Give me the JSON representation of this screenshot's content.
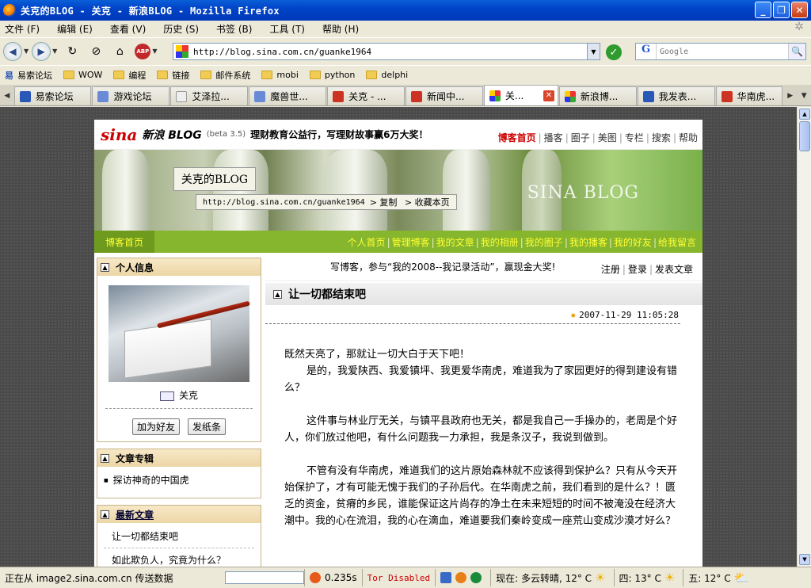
{
  "window": {
    "title": "关克的BLOG - 关克 - 新浪BLOG - Mozilla Firefox"
  },
  "menu": [
    "文件 (F)",
    "编辑 (E)",
    "查看 (V)",
    "历史 (S)",
    "书签 (B)",
    "工具 (T)",
    "帮助 (H)"
  ],
  "nav": {
    "url": "http://blog.sina.com.cn/guanke1964",
    "abp_label": "ABP",
    "search_placeholder": "Google",
    "search_engine_letter": "G"
  },
  "bookmarks": [
    {
      "label": "易索论坛",
      "kind": "yi"
    },
    {
      "label": "WOW",
      "kind": "folder"
    },
    {
      "label": "编程",
      "kind": "folder"
    },
    {
      "label": "链接",
      "kind": "folder"
    },
    {
      "label": "邮件系统",
      "kind": "folder"
    },
    {
      "label": "mobi",
      "kind": "folder"
    },
    {
      "label": "python",
      "kind": "folder"
    },
    {
      "label": "delphi",
      "kind": "folder"
    }
  ],
  "tabs": [
    {
      "label": "易索论坛",
      "color": "#2a58b8"
    },
    {
      "label": "游戏论坛",
      "color": "#6a8ad8"
    },
    {
      "label": "艾泽拉...",
      "color": "#eeeeee"
    },
    {
      "label": "魔兽世...",
      "color": "#6a8ad8"
    },
    {
      "label": "关克 - ...",
      "color": "#cc3322"
    },
    {
      "label": "新闻中...",
      "color": "#cc3322"
    },
    {
      "label": "关...",
      "color": "#e8a020",
      "active": true
    },
    {
      "label": "新浪博...",
      "color": "#e8a020"
    },
    {
      "label": "我发表...",
      "color": "#2a58b8"
    },
    {
      "label": "华南虎...",
      "color": "#cc3322"
    }
  ],
  "blog": {
    "sina_logo": "sina",
    "sina_blog": "新浪 BLOG",
    "beta": "(beta 3.5)",
    "promo": "理财教育公益行，写理财故事赢6万大奖！",
    "topnav": [
      "博客首页",
      "播客",
      "圈子",
      "美图",
      "专栏",
      "搜索",
      "帮助"
    ],
    "banner_title": "关克的BLOG",
    "banner_url": "http://blog.sina.com.cn/guanke1964",
    "banner_copy": "复制",
    "banner_fav": "收藏本页",
    "banner_watermark": "SINA BLOG",
    "greennav_home": "博客首页",
    "greennav_items": [
      "个人首页",
      "管理博客",
      "我的文章",
      "我的相册",
      "我的圈子",
      "我的播客",
      "我的好友",
      "给我留言"
    ]
  },
  "sidebar": {
    "profile_title": "个人信息",
    "username": "关克",
    "add_friend": "加为好友",
    "send_note": "发纸条",
    "columns_title": "文章专辑",
    "columns_items": [
      "探访神奇的中国虎"
    ],
    "recent_title": "最新文章",
    "recent_items": [
      "让一切都结束吧",
      "如此欺负人，究竟为什么？"
    ]
  },
  "main": {
    "promo_line": "写博客，参与“我的2008--我记录活动”，赢现金大奖!",
    "links": [
      "注册",
      "登录",
      "发表文章"
    ],
    "article_title": "让一切都结束吧",
    "article_date": "2007-11-29 11:05:28",
    "paragraphs": [
      "既然天亮了，那就让一切大白于天下吧！",
      "是的，我爱陕西、我爱镇坪、我更爱华南虎，难道我为了家园更好的得到建设有错么？",
      "这件事与林业厅无关，与镇平县政府也无关，都是我自己一手操办的，老周是个好人，你们放过他吧，有什么问题我一力承担，我是条汉子，我说到做到。",
      "不管有没有华南虎，难道我们的这片原始森林就不应该得到保护么？只有从今天开始保护了，才有可能无愧于我们的子孙后代。在华南虎之前，我们看到的是什么？！匮乏的资金，贫瘠的乡民，谁能保证这片尚存的净土在未来短短的时间不被淹没在经济大潮中。我的心在流泪，我的心在滴血，难道要我们秦岭变成一座荒山变成沙漠才好么？"
    ]
  },
  "status": {
    "text": "正在从 image2.sina.com.cn 传送数据",
    "time": "0.235s",
    "tor": "Tor Disabled",
    "weather_now": "现在: 多云转晴, 12° C",
    "weather_thu": "四: 13° C",
    "weather_fri": "五: 12° C"
  }
}
